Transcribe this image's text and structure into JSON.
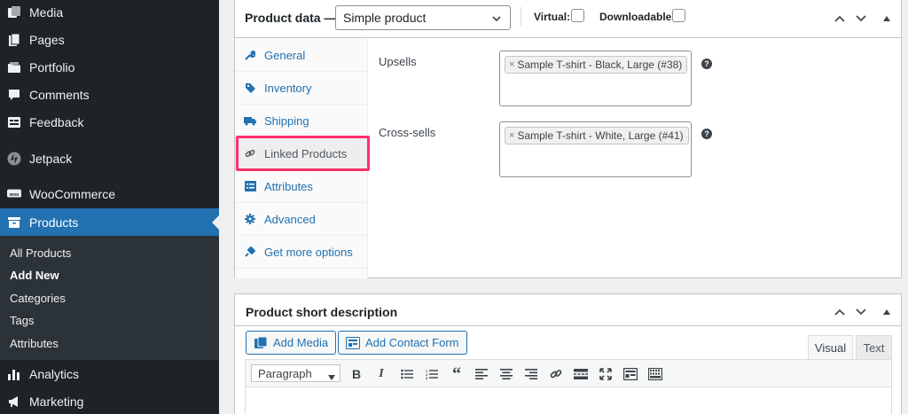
{
  "sidebar": {
    "items": [
      {
        "label": "Media",
        "icon": "media-icon"
      },
      {
        "label": "Pages",
        "icon": "pages-icon"
      },
      {
        "label": "Portfolio",
        "icon": "portfolio-icon"
      },
      {
        "label": "Comments",
        "icon": "comments-icon"
      },
      {
        "label": "Feedback",
        "icon": "feedback-icon"
      },
      {
        "label": "Jetpack",
        "icon": "jetpack-icon"
      },
      {
        "label": "WooCommerce",
        "icon": "woocommerce-icon"
      },
      {
        "label": "Products",
        "icon": "products-icon"
      },
      {
        "label": "Analytics",
        "icon": "analytics-icon"
      },
      {
        "label": "Marketing",
        "icon": "marketing-icon"
      }
    ],
    "submenu": [
      "All Products",
      "Add New",
      "Categories",
      "Tags",
      "Attributes"
    ]
  },
  "product_data": {
    "title": "Product data —",
    "product_type": "Simple product",
    "virtual_label": "Virtual:",
    "downloadable_label": "Downloadable:",
    "tabs": [
      {
        "label": "General",
        "icon": "wrench-icon"
      },
      {
        "label": "Inventory",
        "icon": "tag-icon"
      },
      {
        "label": "Shipping",
        "icon": "truck-icon"
      },
      {
        "label": "Linked Products",
        "icon": "link-icon"
      },
      {
        "label": "Attributes",
        "icon": "list-icon"
      },
      {
        "label": "Advanced",
        "icon": "gear-icon"
      },
      {
        "label": "Get more options",
        "icon": "plugin-icon"
      }
    ],
    "upsells_label": "Upsells",
    "upsells_value": "Sample T-shirt - Black, Large (#38)",
    "crosssells_label": "Cross-sells",
    "crosssells_value": "Sample T-shirt - White, Large (#41)",
    "help_glyph": "?"
  },
  "short_description": {
    "title": "Product short description",
    "add_media": "Add Media",
    "add_contact_form": "Add Contact Form",
    "visual_tab": "Visual",
    "text_tab": "Text",
    "format": "Paragraph",
    "toolbar_icons": [
      "bold-icon",
      "italic-icon",
      "bullet-list-icon",
      "numbered-list-icon",
      "blockquote-icon",
      "align-left-icon",
      "align-center-icon",
      "align-right-icon",
      "link-icon",
      "read-more-icon",
      "fullscreen-icon",
      "contact-form-icon",
      "toolbar-toggle-icon"
    ]
  },
  "colors": {
    "sidebar_bg": "#1d2327",
    "accent": "#2271b1",
    "highlight": "#ff2f6d"
  }
}
